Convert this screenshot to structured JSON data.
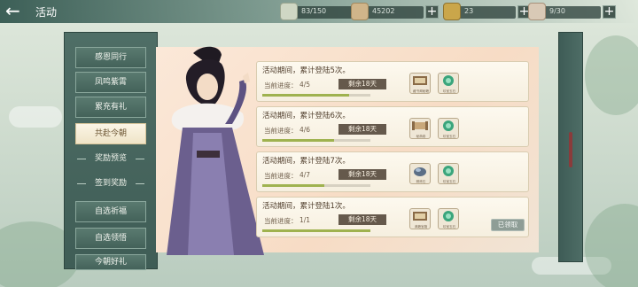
{
  "header": {
    "title": "活动",
    "back_icon": "back-arrow-icon"
  },
  "resources": [
    {
      "icon": "rice-bowl-icon",
      "value": "83/150",
      "color": "#cfd7c4"
    },
    {
      "icon": "silver-ingot-icon",
      "value": "45202",
      "color": "#d0b58a"
    },
    {
      "icon": "gold-ingot-icon",
      "value": "23",
      "color": "#caa64a"
    },
    {
      "icon": "mahjong-ticket-icon",
      "value": "9/30",
      "color": "#d9c9b6"
    }
  ],
  "menu": {
    "items": [
      {
        "label": "感恩同行",
        "type": "button"
      },
      {
        "label": "凤鸣紫霄",
        "type": "button"
      },
      {
        "label": "累充有礼",
        "type": "button"
      },
      {
        "label": "共赴今朝",
        "type": "active"
      },
      {
        "label": "奖励预览",
        "type": "header"
      },
      {
        "label": "签到奖励",
        "type": "header"
      },
      {
        "label": "自选祈福",
        "type": "button"
      },
      {
        "label": "自选领悟",
        "type": "button"
      },
      {
        "label": "今朝好礼",
        "type": "button"
      }
    ]
  },
  "tasks": [
    {
      "desc": "活动期间，累计登陆5次。",
      "progress_label": "当前进度：",
      "progress": "4/5",
      "fraction": 0.8,
      "remaining": "剩余18天",
      "rewards": [
        {
          "icon": "book-icon",
          "caption": "藏书阁秘籍"
        },
        {
          "icon": "jade-icon",
          "caption": "珍宝玉石"
        }
      ],
      "claimed": ""
    },
    {
      "desc": "活动期间，累计登陆6次。",
      "progress_label": "当前进度：",
      "progress": "4/6",
      "fraction": 0.6667,
      "remaining": "剩余18天",
      "rewards": [
        {
          "icon": "scroll-icon",
          "caption": "秘典卷"
        },
        {
          "icon": "jade-icon",
          "caption": "珍宝玉石"
        }
      ],
      "claimed": ""
    },
    {
      "desc": "活动期间，累计登陆7次。",
      "progress_label": "当前进度：",
      "progress": "4/7",
      "fraction": 0.5714,
      "remaining": "剩余18天",
      "rewards": [
        {
          "icon": "stone-icon",
          "caption": "精炼石"
        },
        {
          "icon": "jade-icon",
          "caption": "珍宝玉石"
        }
      ],
      "claimed": ""
    },
    {
      "desc": "活动期间，累计登陆1次。",
      "progress_label": "当前进度：",
      "progress": "1/1",
      "fraction": 1.0,
      "remaining": "剩余18天",
      "rewards": [
        {
          "icon": "book-icon",
          "caption": "典籍宝箱"
        },
        {
          "icon": "jade-icon",
          "caption": "珍宝玉石"
        }
      ],
      "claimed": "已领取"
    }
  ]
}
